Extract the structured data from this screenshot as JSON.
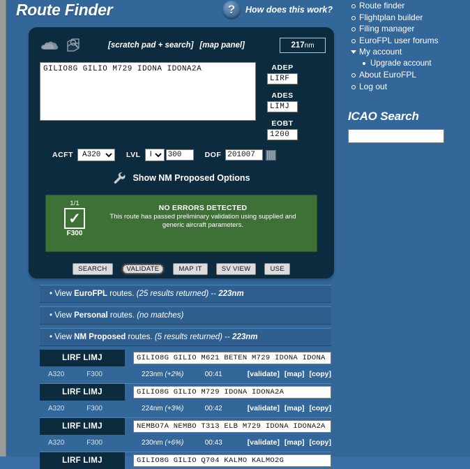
{
  "header": {
    "title": "Route Finder",
    "help_label": "How does this work?",
    "help_icon_glyph": "?"
  },
  "panel": {
    "icons": [
      "cloud-icon",
      "map-layers-icon"
    ],
    "links": [
      "[scratch pad + search]",
      "[map panel]"
    ],
    "distance": "217",
    "distance_unit": "nm",
    "route_text": "GILIO8G GILIO M729 IDONA IDONA2A",
    "fields": {
      "adep_label": "ADEP",
      "adep_value": "LIRF",
      "ades_label": "ADES",
      "ades_value": "LIMJ",
      "eobt_label": "EOBT",
      "eobt_value": "1200"
    },
    "form": {
      "acft_label": "ACFT",
      "acft_value": "A320",
      "lvl_label": "LVL",
      "lvl_unit": "F",
      "lvl_value": "300",
      "dof_label": "DOF",
      "dof_value": "201007",
      "calendar_icon": "calendar-icon"
    },
    "nm_options_label": "Show NM Proposed Options",
    "nm_options_icon": "wrench-icon"
  },
  "validation": {
    "fraction": "1/1",
    "level": "F300",
    "check_icon": "check-icon",
    "title": "NO ERRORS DETECTED",
    "description": "This route has passed preliminary validation using supplied and generic aircraft parameters.",
    "background_color": "#3d7135"
  },
  "actions": [
    {
      "label": "SEARCH",
      "focused": false
    },
    {
      "label": "VALIDATE",
      "focused": true
    },
    {
      "label": "MAP IT",
      "focused": false
    },
    {
      "label": "SV VIEW",
      "focused": false
    },
    {
      "label": "USE",
      "focused": false
    }
  ],
  "result_bars": [
    {
      "prefix": "• View ",
      "source": "EuroFPL",
      "mid": " routes. ",
      "count": "(25 results returned)",
      "sep": " -- ",
      "distance": "223nm"
    },
    {
      "prefix": "• View ",
      "source": "Personal",
      "mid": " routes. ",
      "count": "(no matches)",
      "sep": "",
      "distance": ""
    },
    {
      "prefix": "• View ",
      "source": "NM Proposed",
      "mid": " routes. ",
      "count": "(5 results returned)",
      "sep": " -- ",
      "distance": "223nm"
    }
  ],
  "route_results": [
    {
      "pair": "LIRF LIMJ",
      "route": "GILIO8G GILIO M621 BETEN M729 IDONA IDONA",
      "acft": "A320",
      "level": "F300",
      "distance": "223nm",
      "delta": "(+2%)",
      "time": "00:41",
      "links": [
        "[validate]",
        "[map]",
        "[copy]"
      ]
    },
    {
      "pair": "LIRF LIMJ",
      "route": "GILIO8G GILIO M729 IDONA IDONA2A",
      "acft": "A320",
      "level": "F300",
      "distance": "224nm",
      "delta": "(+3%)",
      "time": "00:42",
      "links": [
        "[validate]",
        "[map]",
        "[copy]"
      ]
    },
    {
      "pair": "LIRF LIMJ",
      "route": "NEMBO7A NEMBO T313 ELB M729 IDONA IDONA2A",
      "acft": "A320",
      "level": "F300",
      "distance": "230nm",
      "delta": "(+6%)",
      "time": "00:43",
      "links": [
        "[validate]",
        "[map]",
        "[copy]"
      ]
    },
    {
      "pair": "LIRF LIMJ",
      "route": "GILIO8G GILIO Q704 KALMO KALMO2G",
      "acft": "",
      "level": "",
      "distance": "",
      "delta": "",
      "time": "",
      "links": []
    }
  ],
  "sidebar": {
    "items": [
      {
        "label": "Route finder",
        "style": "ring"
      },
      {
        "label": "Flightplan builder",
        "style": "ring"
      },
      {
        "label": "Filing manager",
        "style": "ring"
      },
      {
        "label": "EuroFPL user forums",
        "style": "ring"
      },
      {
        "label": "My account",
        "style": "triangle"
      },
      {
        "label": "Upgrade account",
        "style": "dot"
      },
      {
        "label": "About EuroFPL",
        "style": "ring"
      },
      {
        "label": "Log out",
        "style": "ring"
      }
    ],
    "icao_search": {
      "title": "ICAO Search",
      "value": "",
      "placeholder": ""
    }
  }
}
